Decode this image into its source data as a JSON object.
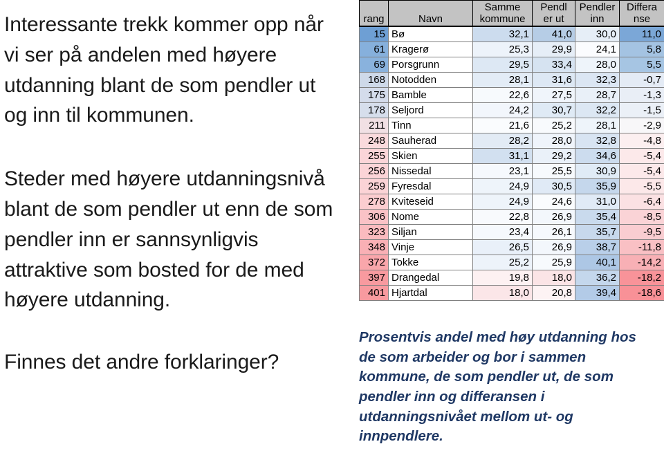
{
  "left": {
    "paragraphs": [
      "Interessante trekk kommer opp når vi ser på andelen med høyere utdanning blant de som pendler ut og inn til kommunen.",
      "Steder med høyere utdanningsnivå blant de som pendler ut enn de som pendler inn er sannsynligvis attraktive som bosted for de med høyere utdanning.",
      "Finnes det andre forklaringer?"
    ]
  },
  "caption": {
    "text": "Prosentvis andel med høy utdanning hos de som arbeider og bor i sammen kommune, de som pendler ut, de som pendler inn og differansen i utdanningsnivået mellom ut- og innpendlere.",
    "color": "#1F3864"
  },
  "table": {
    "headers": [
      {
        "line1": "",
        "line2": "rang"
      },
      {
        "line1": "",
        "line2": "Navn"
      },
      {
        "line1": "Samme",
        "line2": "kommune"
      },
      {
        "line1": "Pendl",
        "line2": "er ut"
      },
      {
        "line1": "Pendler",
        "line2": "inn"
      },
      {
        "line1": "Differa",
        "line2": "nse"
      }
    ],
    "header_bg": "#c3c3c3",
    "rows": [
      {
        "rang": "15",
        "navn": "Bø",
        "samme": "32,1",
        "ut": "41,0",
        "inn": "30,0",
        "diff": "11,0",
        "bg": {
          "rang": "#6e9fd4",
          "samme": "#ccdcee",
          "ut": "#b6cde6",
          "inn": "#e6eef7",
          "diff": "#7ba7d7"
        }
      },
      {
        "rang": "61",
        "navn": "Kragerø",
        "samme": "25,3",
        "ut": "29,9",
        "inn": "24,1",
        "diff": "5,8",
        "bg": {
          "rang": "#86b0dc",
          "samme": "#edf3fa",
          "ut": "#e6eef7",
          "inn": "#fbfcfe",
          "diff": "#a4c3e2"
        }
      },
      {
        "rang": "69",
        "navn": "Porsgrunn",
        "samme": "29,5",
        "ut": "33,4",
        "inn": "28,0",
        "diff": "5,5",
        "bg": {
          "rang": "#89b2dd",
          "samme": "#dde8f4",
          "ut": "#d6e3f1",
          "inn": "#eef4fa",
          "diff": "#a6c5e3"
        }
      },
      {
        "rang": "168",
        "navn": "Notodden",
        "samme": "28,1",
        "ut": "31,6",
        "inn": "32,3",
        "diff": "-0,7",
        "bg": {
          "rang": "#ced9e9",
          "samme": "#e3ecf6",
          "ut": "#dde8f4",
          "inn": "#dbe6f3",
          "diff": "#e4ebf5"
        }
      },
      {
        "rang": "175",
        "navn": "Bamble",
        "samme": "22,6",
        "ut": "27,5",
        "inn": "28,7",
        "diff": "-1,3",
        "bg": {
          "rang": "#d4dceb",
          "samme": "#f7fafd",
          "ut": "#f0f5fb",
          "inn": "#e9f0f8",
          "diff": "#e9eef6"
        }
      },
      {
        "rang": "178",
        "navn": "Seljord",
        "samme": "24,2",
        "ut": "30,7",
        "inn": "32,2",
        "diff": "-1,5",
        "bg": {
          "rang": "#d6deec",
          "samme": "#f2f6fc",
          "ut": "#dfeaf5",
          "inn": "#dce7f3",
          "diff": "#ebf0f7"
        }
      },
      {
        "rang": "211",
        "navn": "Tinn",
        "samme": "21,6",
        "ut": "25,2",
        "inn": "28,1",
        "diff": "-2,9",
        "bg": {
          "rang": "#f1e0e4",
          "samme": "#fafcfe",
          "ut": "#f8fafd",
          "inn": "#eef4fa",
          "diff": "#f8f7f9"
        }
      },
      {
        "rang": "248",
        "navn": "Sauherad",
        "samme": "28,2",
        "ut": "28,0",
        "inn": "32,8",
        "diff": "-4,8",
        "bg": {
          "rang": "#fadadd",
          "samme": "#e2ebf5",
          "ut": "#eff4fb",
          "inn": "#d8e4f2",
          "diff": "#fceff0"
        }
      },
      {
        "rang": "255",
        "navn": "Skien",
        "samme": "31,1",
        "ut": "29,2",
        "inn": "34,6",
        "diff": "-5,4",
        "bg": {
          "rang": "#fbd5d8",
          "samme": "#d2e0f0",
          "ut": "#eaf1f9",
          "inn": "#ccdcee",
          "diff": "#fce9ea"
        }
      },
      {
        "rang": "256",
        "navn": "Nissedal",
        "samme": "23,1",
        "ut": "25,5",
        "inn": "30,9",
        "diff": "-5,4",
        "bg": {
          "rang": "#fbd4d7",
          "samme": "#f6f9fd",
          "ut": "#f7fafd",
          "inn": "#e0ebf6",
          "diff": "#fce9ea"
        }
      },
      {
        "rang": "259",
        "navn": "Fyresdal",
        "samme": "24,9",
        "ut": "30,5",
        "inn": "35,9",
        "diff": "-5,5",
        "bg": {
          "rang": "#fbd3d6",
          "samme": "#eef4fa",
          "ut": "#e0eaf6",
          "inn": "#c5d7ec",
          "diff": "#fce8e9"
        }
      },
      {
        "rang": "278",
        "navn": "Kviteseid",
        "samme": "24,9",
        "ut": "24,6",
        "inn": "31,0",
        "diff": "-6,4",
        "bg": {
          "rang": "#fbcdd0",
          "samme": "#eef4fa",
          "ut": "#fafcfe",
          "inn": "#e0eaf6",
          "diff": "#fbe1e3"
        }
      },
      {
        "rang": "306",
        "navn": "Nome",
        "samme": "22,8",
        "ut": "26,9",
        "inn": "35,4",
        "diff": "-8,5",
        "bg": {
          "rang": "#fac2c6",
          "samme": "#f8fafd",
          "ut": "#f3f7fc",
          "inn": "#c9daed",
          "diff": "#fad3d6"
        }
      },
      {
        "rang": "323",
        "navn": "Siljan",
        "samme": "23,4",
        "ut": "26,1",
        "inn": "35,7",
        "diff": "-9,5",
        "bg": {
          "rang": "#fabbbf",
          "samme": "#f6f9fd",
          "ut": "#f6f9fd",
          "inn": "#c7d8ec",
          "diff": "#f9cdd1"
        }
      },
      {
        "rang": "348",
        "navn": "Vinje",
        "samme": "26,5",
        "ut": "26,9",
        "inn": "38,7",
        "diff": "-11,8",
        "bg": {
          "rang": "#f9b0b5",
          "samme": "#e9f0f9",
          "ut": "#f3f7fc",
          "inn": "#b9cfe9",
          "diff": "#f9c0c4"
        }
      },
      {
        "rang": "372",
        "navn": "Tokke",
        "samme": "25,2",
        "ut": "25,9",
        "inn": "40,1",
        "diff": "-14,2",
        "bg": {
          "rang": "#f9a6ab",
          "samme": "#edf3fa",
          "ut": "#f7fafd",
          "inn": "#adc7e5",
          "diff": "#f8b0b5"
        }
      },
      {
        "rang": "397",
        "navn": "Drangedal",
        "samme": "19,8",
        "ut": "18,0",
        "inn": "36,2",
        "diff": "-18,2",
        "bg": {
          "rang": "#f89a9f",
          "samme": "#fdf1f2",
          "ut": "#fbe4e6",
          "inn": "#c4d7ec",
          "diff": "#f89399"
        }
      },
      {
        "rang": "401",
        "navn": "Hjartdal",
        "samme": "18,0",
        "ut": "20,8",
        "inn": "39,4",
        "diff": "-18,6",
        "bg": {
          "rang": "#f89a9f",
          "samme": "#fbe6e8",
          "ut": "#fdf3f4",
          "inn": "#b3cbe7",
          "diff": "#f89197"
        }
      }
    ]
  },
  "chart_data": {
    "type": "table",
    "title": "Prosentvis andel med høy utdanning hos de som arbeider og bor i sammen kommune, de som pendler ut, de som pendler inn og differansen i utdanningsnivået mellom ut- og innpendlere.",
    "columns": [
      "rang",
      "Navn",
      "Samme kommune",
      "Pendler ut",
      "Pendler inn",
      "Differanse"
    ],
    "rows": [
      [
        "15",
        "Bø",
        32.1,
        41.0,
        30.0,
        11.0
      ],
      [
        "61",
        "Kragerø",
        25.3,
        29.9,
        24.1,
        5.8
      ],
      [
        "69",
        "Porsgrunn",
        29.5,
        33.4,
        28.0,
        5.5
      ],
      [
        "168",
        "Notodden",
        28.1,
        31.6,
        32.3,
        -0.7
      ],
      [
        "175",
        "Bamble",
        22.6,
        27.5,
        28.7,
        -1.3
      ],
      [
        "178",
        "Seljord",
        24.2,
        30.7,
        32.2,
        -1.5
      ],
      [
        "211",
        "Tinn",
        21.6,
        25.2,
        28.1,
        -2.9
      ],
      [
        "248",
        "Sauherad",
        28.2,
        28.0,
        32.8,
        -4.8
      ],
      [
        "255",
        "Skien",
        31.1,
        29.2,
        34.6,
        -5.4
      ],
      [
        "256",
        "Nissedal",
        23.1,
        25.5,
        30.9,
        -5.4
      ],
      [
        "259",
        "Fyresdal",
        24.9,
        30.5,
        35.9,
        -5.5
      ],
      [
        "278",
        "Kviteseid",
        24.9,
        24.6,
        31.0,
        -6.4
      ],
      [
        "306",
        "Nome",
        22.8,
        26.9,
        35.4,
        -8.5
      ],
      [
        "323",
        "Siljan",
        23.4,
        26.1,
        35.7,
        -9.5
      ],
      [
        "348",
        "Vinje",
        26.5,
        26.9,
        38.7,
        -11.8
      ],
      [
        "372",
        "Tokke",
        25.2,
        25.9,
        40.1,
        -14.2
      ],
      [
        "397",
        "Drangedal",
        19.8,
        18.0,
        36.2,
        -18.2
      ],
      [
        "401",
        "Hjartdal",
        18.0,
        20.8,
        39.4,
        -18.6
      ]
    ]
  }
}
